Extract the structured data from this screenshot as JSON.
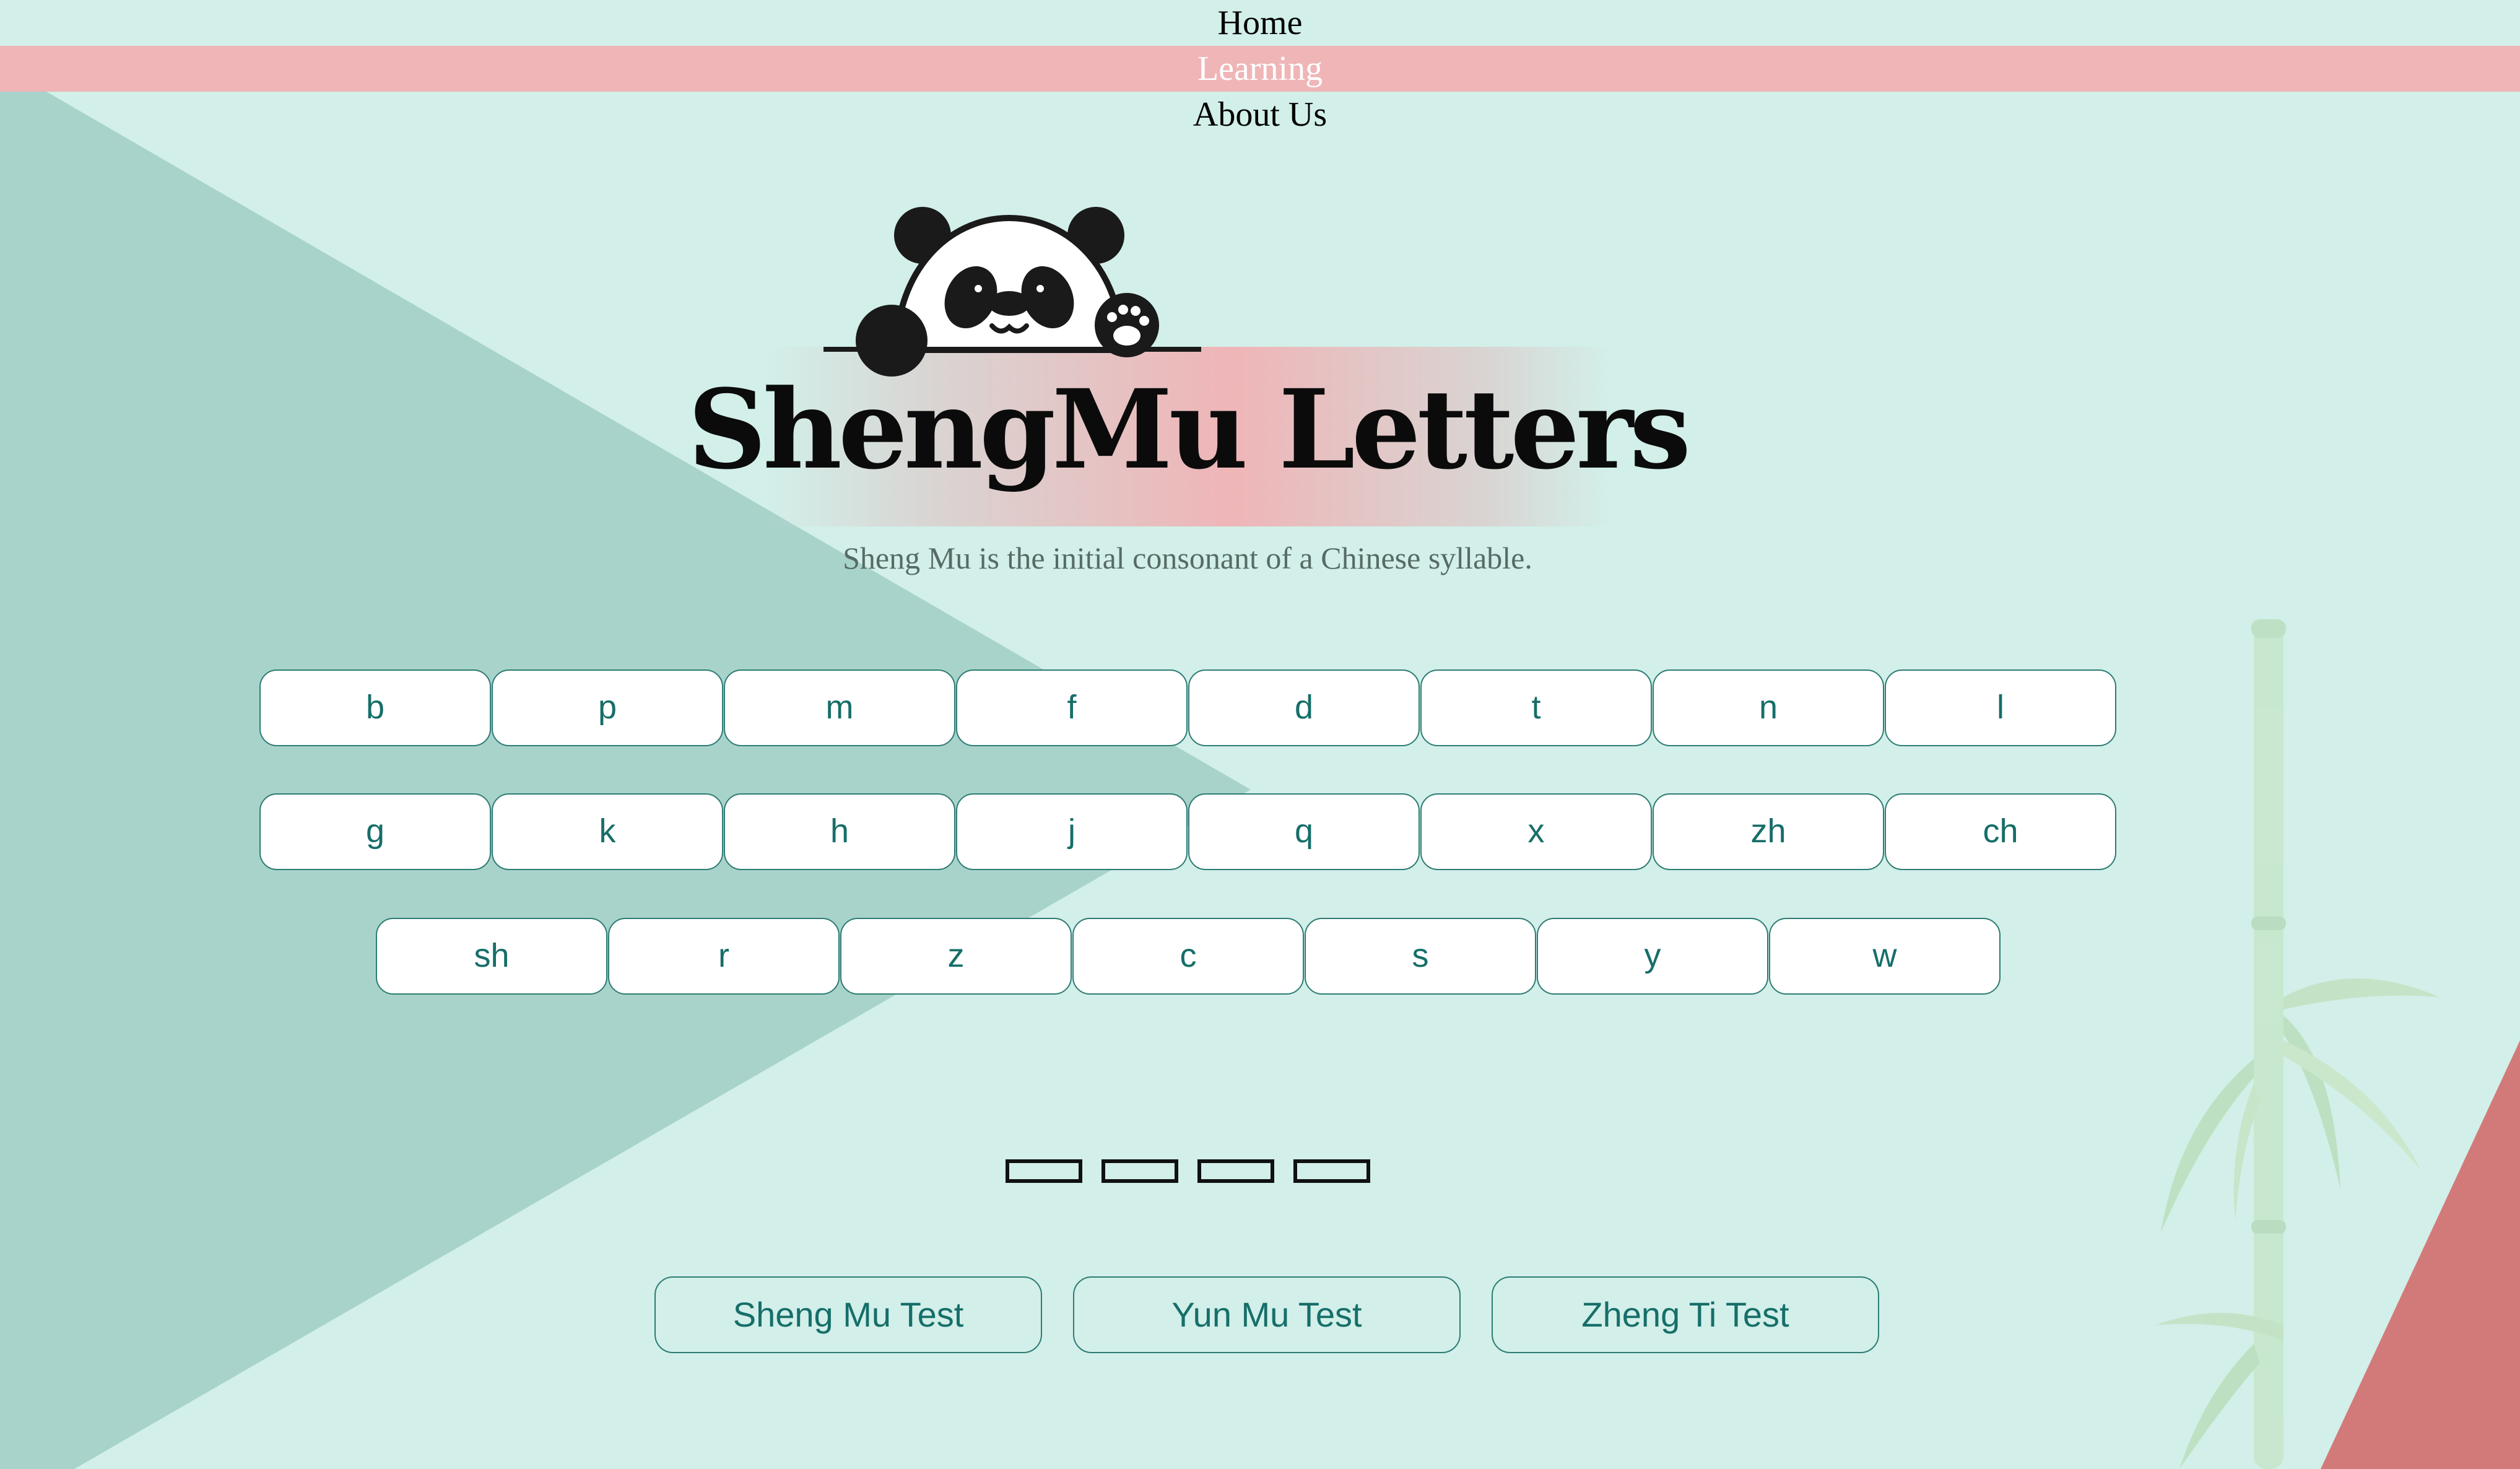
{
  "nav": {
    "items": [
      {
        "label": "Home",
        "active": false
      },
      {
        "label": "Learning",
        "active": true
      },
      {
        "label": "About Us",
        "active": false
      }
    ]
  },
  "hero": {
    "title": "ShengMu Letters",
    "subtitle": "Sheng Mu is the initial consonant of a Chinese syllable."
  },
  "letters": {
    "row1": [
      "b",
      "p",
      "m",
      "f",
      "d",
      "t",
      "n",
      "l"
    ],
    "row2": [
      "g",
      "k",
      "h",
      "j",
      "q",
      "x",
      "zh",
      "ch"
    ],
    "row3": [
      "sh",
      "r",
      "z",
      "c",
      "s",
      "y",
      "w"
    ]
  },
  "pagination": {
    "count": 4
  },
  "tests": {
    "items": [
      "Sheng Mu Test",
      "Yun Mu Test",
      "Zheng Ti Test"
    ]
  },
  "colors": {
    "background": "#d2efe9",
    "triangle": "#a8d3cb",
    "nav_active": "#efb5b7",
    "accent_red": "#d27a7a",
    "button_text": "#166e69",
    "button_border": "#2d7c74"
  },
  "icons": [
    "panda-logo-icon",
    "bamboo-decoration-icon"
  ]
}
